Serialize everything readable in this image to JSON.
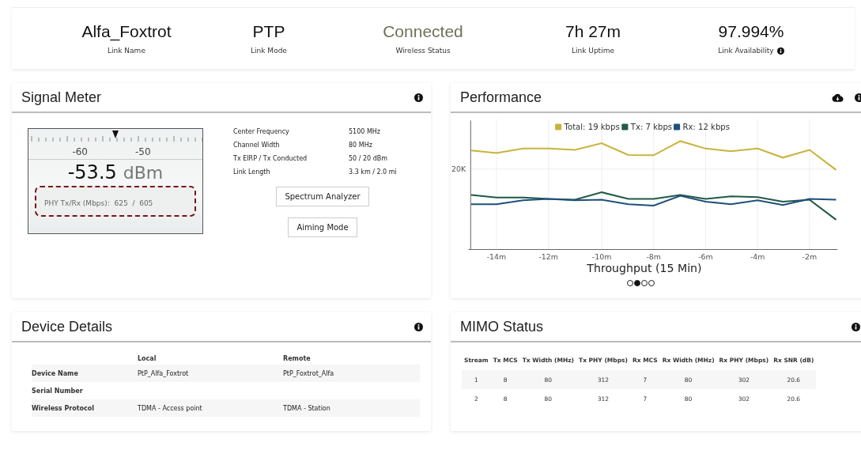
{
  "summary": [
    {
      "value": "Alfa_Foxtrot",
      "label": "Link Name",
      "kind": "plain",
      "info": false
    },
    {
      "value": "PTP",
      "label": "Link Mode",
      "kind": "plain",
      "info": false
    },
    {
      "value": "Connected",
      "label": "Wireless Status",
      "kind": "status",
      "info": false
    },
    {
      "value": "7h 27m",
      "label": "Link Uptime",
      "kind": "plain",
      "info": false
    },
    {
      "value": "97.994%",
      "label": "Link Availability",
      "kind": "plain",
      "info": true
    }
  ],
  "signal_meter": {
    "title": "Signal Meter",
    "scale": [
      "-60",
      "-50"
    ],
    "reading": "-53.5",
    "unit": "dBm",
    "phy": "PHY Tx/Rx (Mbps):  625  /  605",
    "details": [
      {
        "key": "Center Frequency",
        "value": "5100 MHz"
      },
      {
        "key": "Channel Width",
        "value": "80 MHz"
      },
      {
        "key": "Tx EIRP / Tx Conducted",
        "value": "50 / 20 dBm"
      },
      {
        "key": "Link Length",
        "value": "3.3 km / 2.0 mi"
      }
    ],
    "buttons": [
      "Spectrum Analyzer",
      "Aiming Mode"
    ]
  },
  "performance": {
    "title": "Performance",
    "legend": [
      {
        "label": "Total: 19 kbps",
        "color": "#c9b33a"
      },
      {
        "label": "Tx: 7 kbps",
        "color": "#1f5a45"
      },
      {
        "label": "Rx: 12 kbps",
        "color": "#1f4f7a"
      }
    ],
    "y_tick": "20K",
    "x_ticks": [
      "-14m",
      "-12m",
      "-10m",
      "-8m",
      "-6m",
      "-4m",
      "-2m"
    ],
    "xlabel": "Throughput (15 Min)",
    "pages": [
      {
        "selected": false
      },
      {
        "selected": true
      },
      {
        "selected": false
      },
      {
        "selected": false
      }
    ]
  },
  "device_details": {
    "title": "Device Details",
    "columns": [
      "Local",
      "Remote"
    ],
    "rows": [
      {
        "label": "Device Name",
        "local": "PtP_Alfa_Foxtrot",
        "remote": "PtP_Foxtrot_Alfa"
      },
      {
        "label": "Serial Number"
      },
      {
        "label": "Wireless Protocol",
        "local": "TDMA - Access point",
        "remote": "TDMA - Station"
      }
    ]
  },
  "mimo": {
    "title": "MIMO Status",
    "columns": [
      "Stream",
      "Tx MCS",
      "Tx Width (MHz)",
      "Tx PHY (Mbps)",
      "Rx MCS",
      "Rx Width (MHz)",
      "Rx PHY (Mbps)",
      "Rx SNR (dB)"
    ],
    "rows": [
      [
        "1",
        "8",
        "80",
        "312",
        "7",
        "80",
        "302",
        "20.6"
      ],
      [
        "2",
        "8",
        "80",
        "312",
        "7",
        "80",
        "302",
        "20.6"
      ]
    ]
  }
}
